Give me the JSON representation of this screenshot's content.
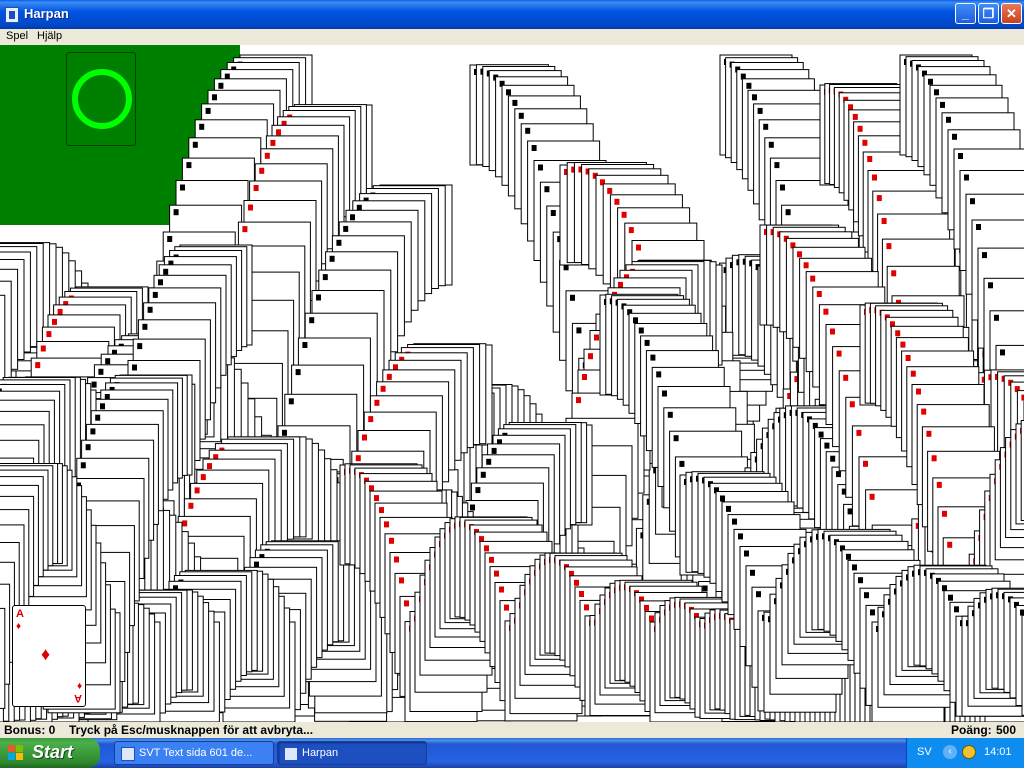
{
  "window": {
    "title": "Harpan",
    "icons": {
      "app": "card-app-icon",
      "minimize": "minimize-icon",
      "maximize": "restore-icon",
      "close": "close-icon"
    }
  },
  "menu": {
    "items": [
      {
        "label": "Spel"
      },
      {
        "label": "Hjälp"
      }
    ]
  },
  "game": {
    "felt_color": "#008000",
    "deck_marker_icon": "empty-deck-ring-icon",
    "deck_marker_color": "#00ff00",
    "last_card": {
      "rank": "A",
      "suit": "♦",
      "suit_color": "#e00000"
    }
  },
  "status": {
    "bonus": "Bonus: 0",
    "hint": "Tryck på Esc/musknappen för att avbryta...",
    "score_label": "Poäng:",
    "score_value": "500"
  },
  "taskbar": {
    "start_label": "Start",
    "tasks": [
      {
        "label": "SVT Text sida 601 de...",
        "icon": "browser-icon",
        "active": false
      },
      {
        "label": "Harpan",
        "icon": "card-app-icon",
        "active": true
      }
    ],
    "tray": {
      "language": "SV",
      "clock": "14:01",
      "icons": [
        "chevron-left-icon",
        "network-icon"
      ]
    }
  }
}
